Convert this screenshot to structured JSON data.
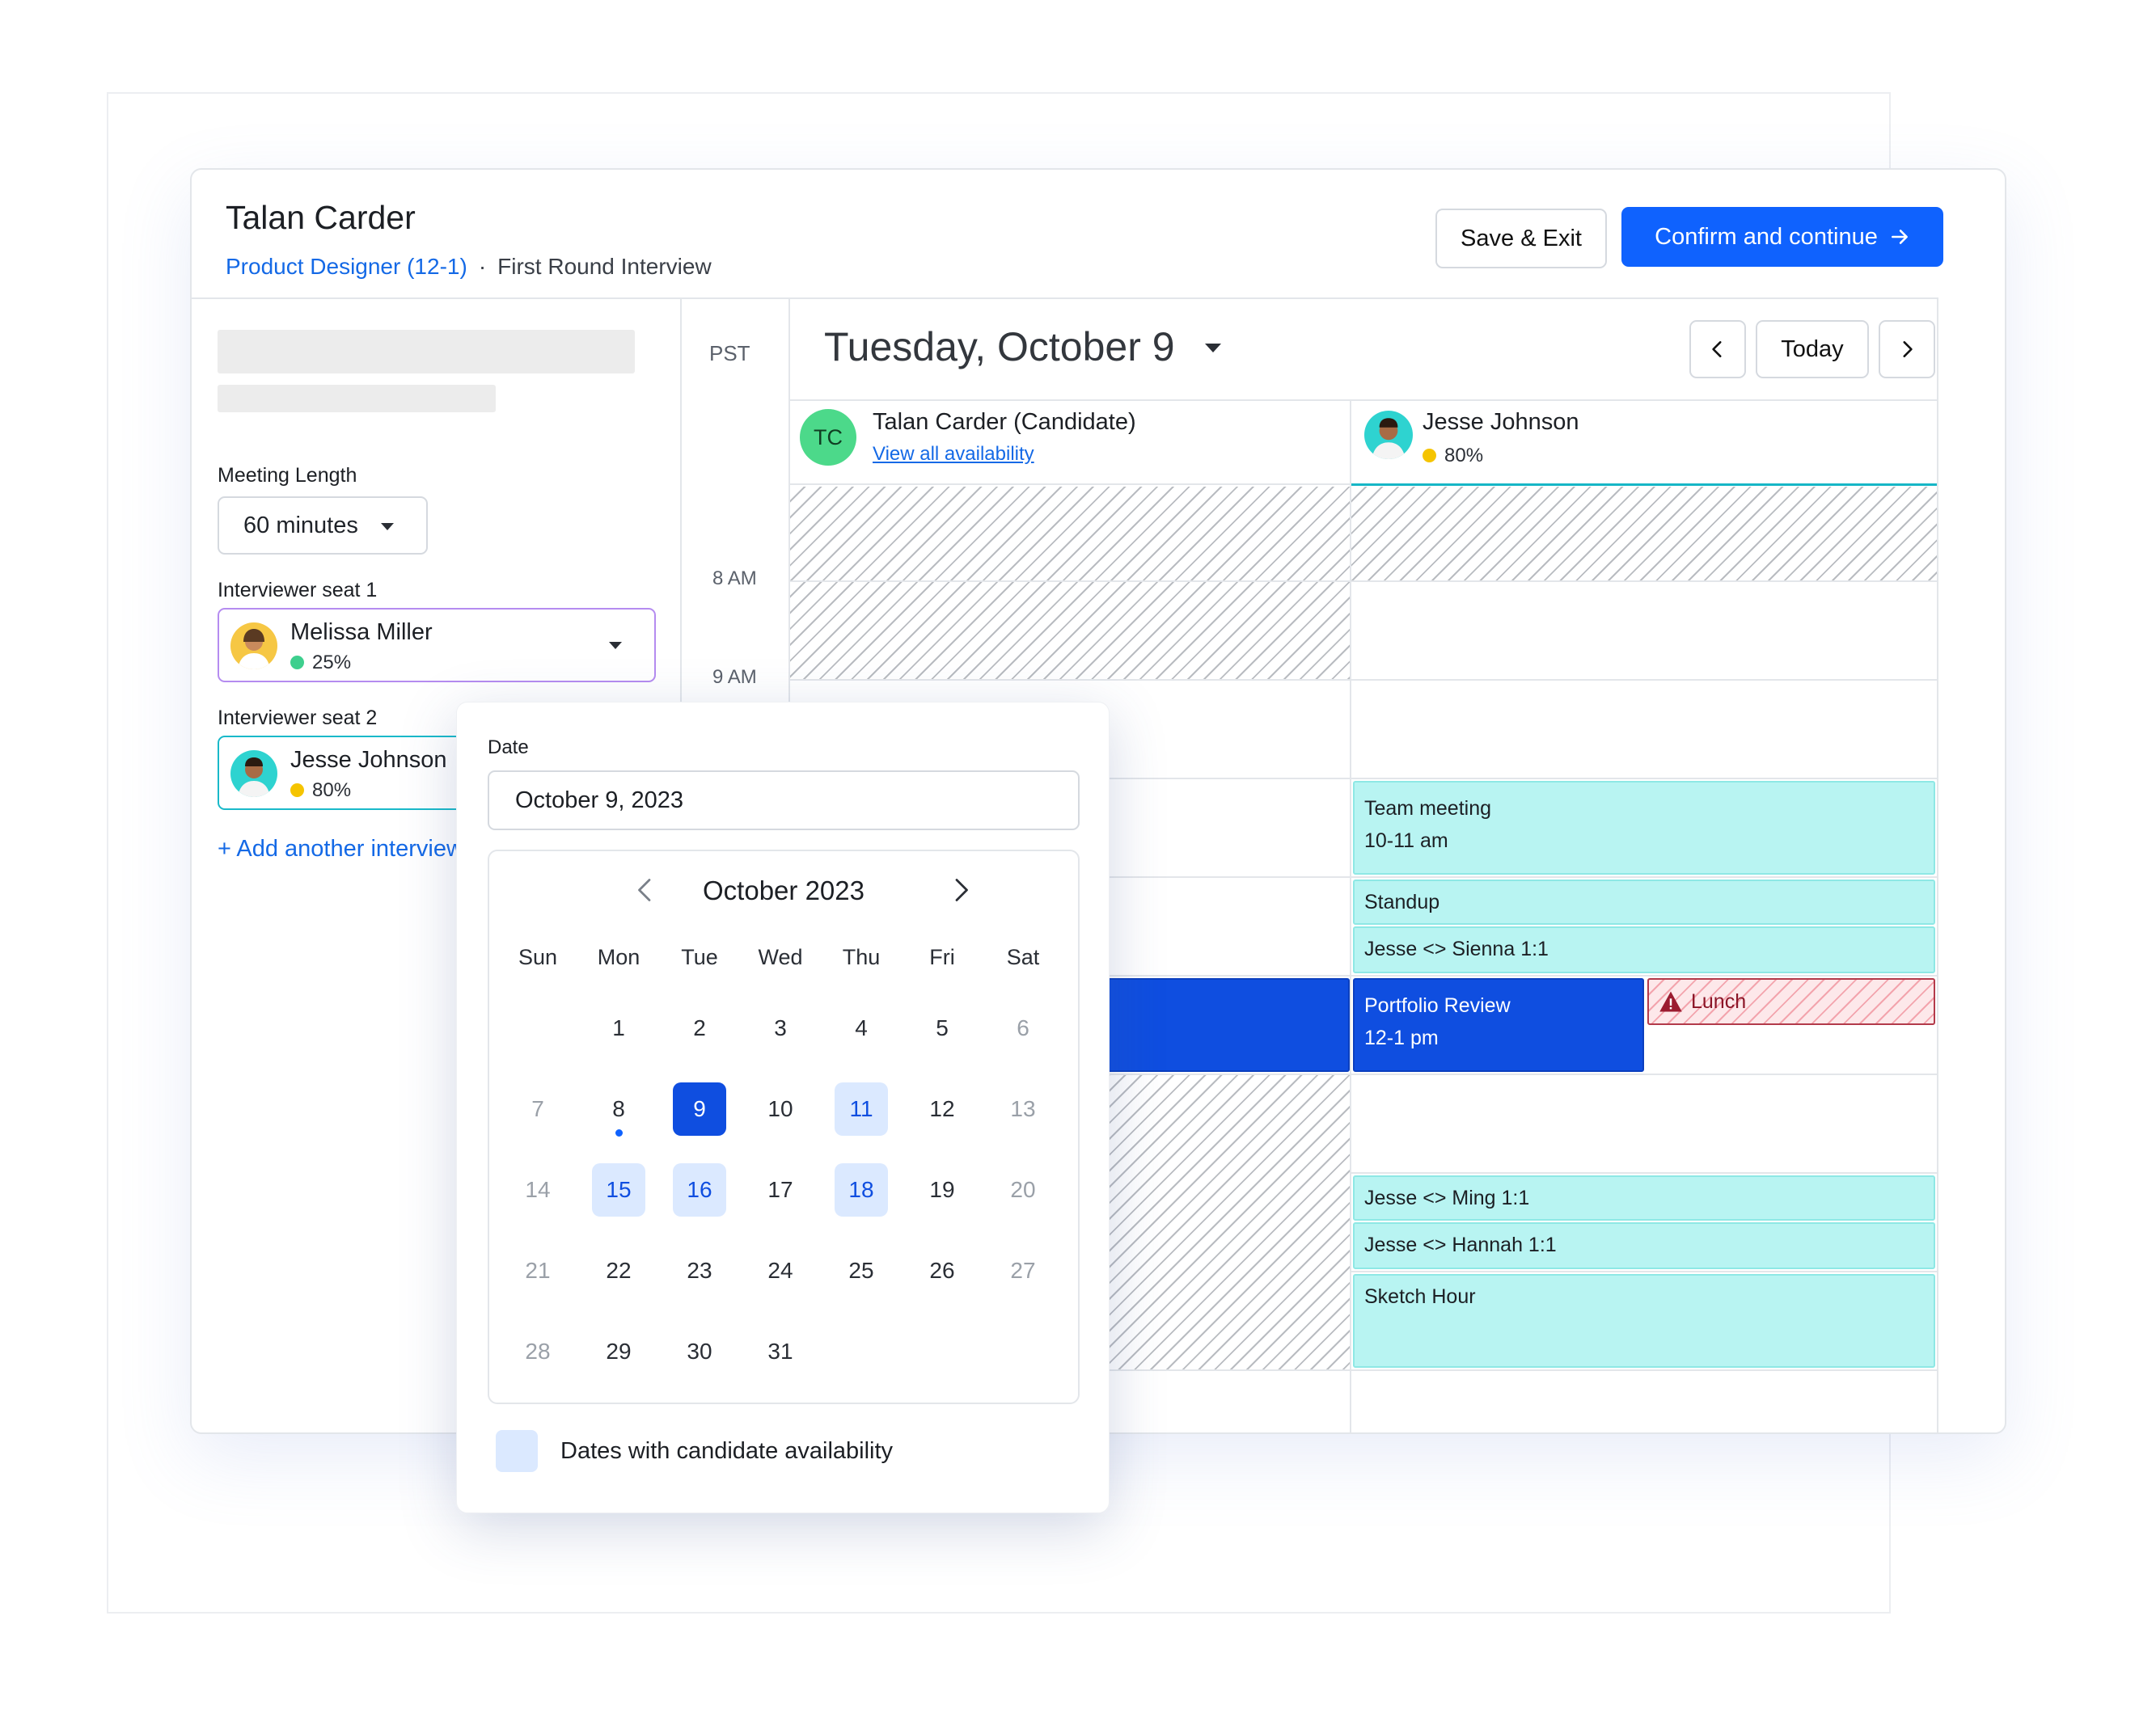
{
  "header": {
    "title": "Talan Carder",
    "job_link": "Product Designer (12-1)",
    "separator": "·",
    "stage": "First Round Interview",
    "save_label": "Save & Exit",
    "confirm_label": "Confirm and continue"
  },
  "sidebar": {
    "meeting_length_label": "Meeting Length",
    "meeting_length_value": "60 minutes",
    "seat1_label": "Interviewer seat 1",
    "seat1": {
      "name": "Melissa Miller",
      "availability": "25%",
      "status_color": "#3ecf8e"
    },
    "seat2_label": "Interviewer seat 2",
    "seat2": {
      "name": "Jesse Johnson",
      "availability": "80%",
      "status_color": "#f5c400"
    },
    "add_link": "+ Add another interviewer"
  },
  "calendar": {
    "timezone": "PST",
    "date_heading": "Tuesday, October 9",
    "today_label": "Today",
    "times": [
      "8 AM",
      "9 AM"
    ],
    "columns": [
      {
        "initials": "TC",
        "name": "Talan Carder (Candidate)",
        "link": "View all availability"
      },
      {
        "name": "Jesse Johnson",
        "availability": "80%",
        "status_color": "#f5c400"
      }
    ],
    "events": {
      "team_meeting": {
        "title": "Team meeting",
        "time": "10-11 am"
      },
      "standup": {
        "title": "Standup"
      },
      "sienna": {
        "title": "Jesse <> Sienna 1:1"
      },
      "portfolio": {
        "title": "Portfolio Review",
        "time": "12-1 pm"
      },
      "lunch": {
        "title": "Lunch"
      },
      "ming": {
        "title": "Jesse <> Ming 1:1"
      },
      "hannah": {
        "title": "Jesse <> Hannah 1:1"
      },
      "sketch": {
        "title": "Sketch Hour"
      }
    }
  },
  "datepicker": {
    "label": "Date",
    "value": "October 9, 2023",
    "month_title": "October 2023",
    "weekdays": [
      "Sun",
      "Mon",
      "Tue",
      "Wed",
      "Thu",
      "Fri",
      "Sat"
    ],
    "legend": "Dates with candidate availability",
    "selected_day": 9,
    "today_day": 8,
    "available_days": [
      11,
      15,
      16,
      18
    ],
    "colors": {
      "selected": "#0f4ee0",
      "available": "#dbe9ff",
      "accent": "#0f62fe"
    }
  }
}
